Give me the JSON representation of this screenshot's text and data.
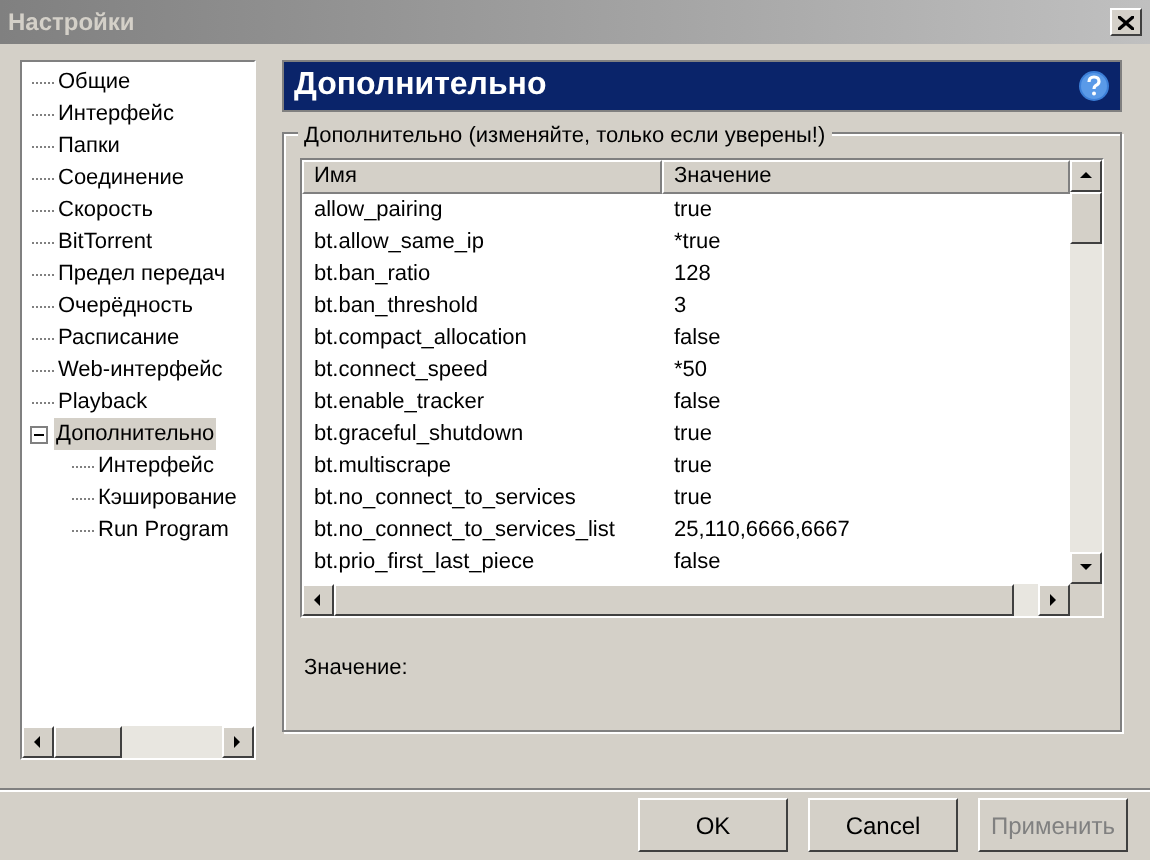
{
  "window": {
    "title": "Настройки",
    "active": false
  },
  "sidebar": {
    "items": [
      {
        "label": "Общие",
        "selected": false
      },
      {
        "label": "Интерфейс",
        "selected": false
      },
      {
        "label": "Папки",
        "selected": false
      },
      {
        "label": "Соединение",
        "selected": false
      },
      {
        "label": "Скорость",
        "selected": false
      },
      {
        "label": "BitTorrent",
        "selected": false
      },
      {
        "label": "Предел передач",
        "selected": false
      },
      {
        "label": "Очерёдность",
        "selected": false
      },
      {
        "label": "Расписание",
        "selected": false
      },
      {
        "label": "Web-интерфейс",
        "selected": false
      },
      {
        "label": "Playback",
        "selected": false
      },
      {
        "label": "Дополнительно",
        "selected": true,
        "expanded": true,
        "children": [
          {
            "label": "Интерфейс",
            "selected": false
          },
          {
            "label": "Кэширование",
            "selected": false
          },
          {
            "label": "Run Program",
            "selected": false
          }
        ]
      }
    ]
  },
  "panel": {
    "title": "Дополнительно",
    "group_title": "Дополнительно (изменяйте, только если уверены!)",
    "table": {
      "columns": [
        "Имя",
        "Значение"
      ],
      "rows": [
        [
          "allow_pairing",
          "true"
        ],
        [
          "bt.allow_same_ip",
          "*true"
        ],
        [
          "bt.ban_ratio",
          "128"
        ],
        [
          "bt.ban_threshold",
          "3"
        ],
        [
          "bt.compact_allocation",
          "false"
        ],
        [
          "bt.connect_speed",
          "*50"
        ],
        [
          "bt.enable_tracker",
          "false"
        ],
        [
          "bt.graceful_shutdown",
          "true"
        ],
        [
          "bt.multiscrape",
          "true"
        ],
        [
          "bt.no_connect_to_services",
          "true"
        ],
        [
          "bt.no_connect_to_services_list",
          "25,110,6666,6667"
        ],
        [
          "bt.prio_first_last_piece",
          "false"
        ]
      ]
    },
    "value_label": "Значение:"
  },
  "buttons": [
    {
      "label": "OK",
      "disabled": false
    },
    {
      "label": "Cancel",
      "disabled": false
    },
    {
      "label": "Применить",
      "disabled": true
    }
  ]
}
